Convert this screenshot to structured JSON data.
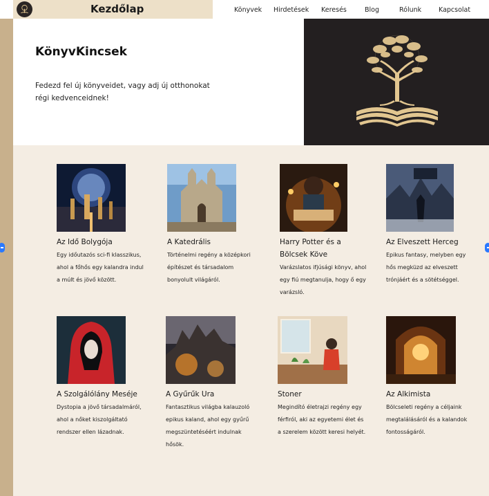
{
  "header": {
    "title": "Kezdőlap"
  },
  "nav": {
    "items": [
      {
        "label": "Könyvek"
      },
      {
        "label": "Hirdetések"
      },
      {
        "label": "Keresés"
      },
      {
        "label": "Blog"
      },
      {
        "label": "Rólunk"
      },
      {
        "label": "Kapcsolat"
      }
    ]
  },
  "hero": {
    "title": "KönyvKincsek",
    "text": "Fedezd fel új könyveidet, vagy adj új otthonokat régi kedvenceidnek!"
  },
  "books": [
    {
      "title": "Az Idő Bolygója",
      "desc": "Egy időutazós sci-fi klasszikus, ahol a főhős egy kalandra indul a múlt és jövő között."
    },
    {
      "title": "A Katedrális",
      "desc": "Történelmi regény a középkori építészet és társadalom bonyolult világáról."
    },
    {
      "title": "Harry Potter és a Bölcsek Köve",
      "desc": "Varázslatos ifjúsági könyv, ahol egy fiú megtanulja, hogy ő egy varázsló."
    },
    {
      "title": "Az Elveszett Herceg",
      "desc": "Epikus fantasy, melyben egy hős megküzd az elveszett trónjáért és a sötétséggel."
    },
    {
      "title": "A Szolgálólány Meséje",
      "desc": "Dystopia a jövő társadalmáról, ahol a nőket kiszolgáltató rendszer ellen lázadnak."
    },
    {
      "title": "A Gyűrűk Ura",
      "desc": "Fantasztikus világba kalauzoló epikus kaland, ahol egy gyűrű megszüntetéséért indulnak hősök."
    },
    {
      "title": "Stoner",
      "desc": "Megindító életrajzi regény egy férfiról, aki az egyetemi élet és a szerelem között keresi helyét."
    },
    {
      "title": "Az Alkimista",
      "desc": "Bölcseleti regény a céljaink megtalálásáról és a kalandok fontosságáról."
    }
  ],
  "icons": {
    "logo": "tree-book-logo-icon",
    "hero": "tree-on-book-illustration"
  },
  "colors": {
    "rail": "#c8b08c",
    "brand_bg": "#ede0c8",
    "section_bg": "#f4ede3",
    "hero_dark": "#231f20",
    "gold": "#e2c690"
  }
}
